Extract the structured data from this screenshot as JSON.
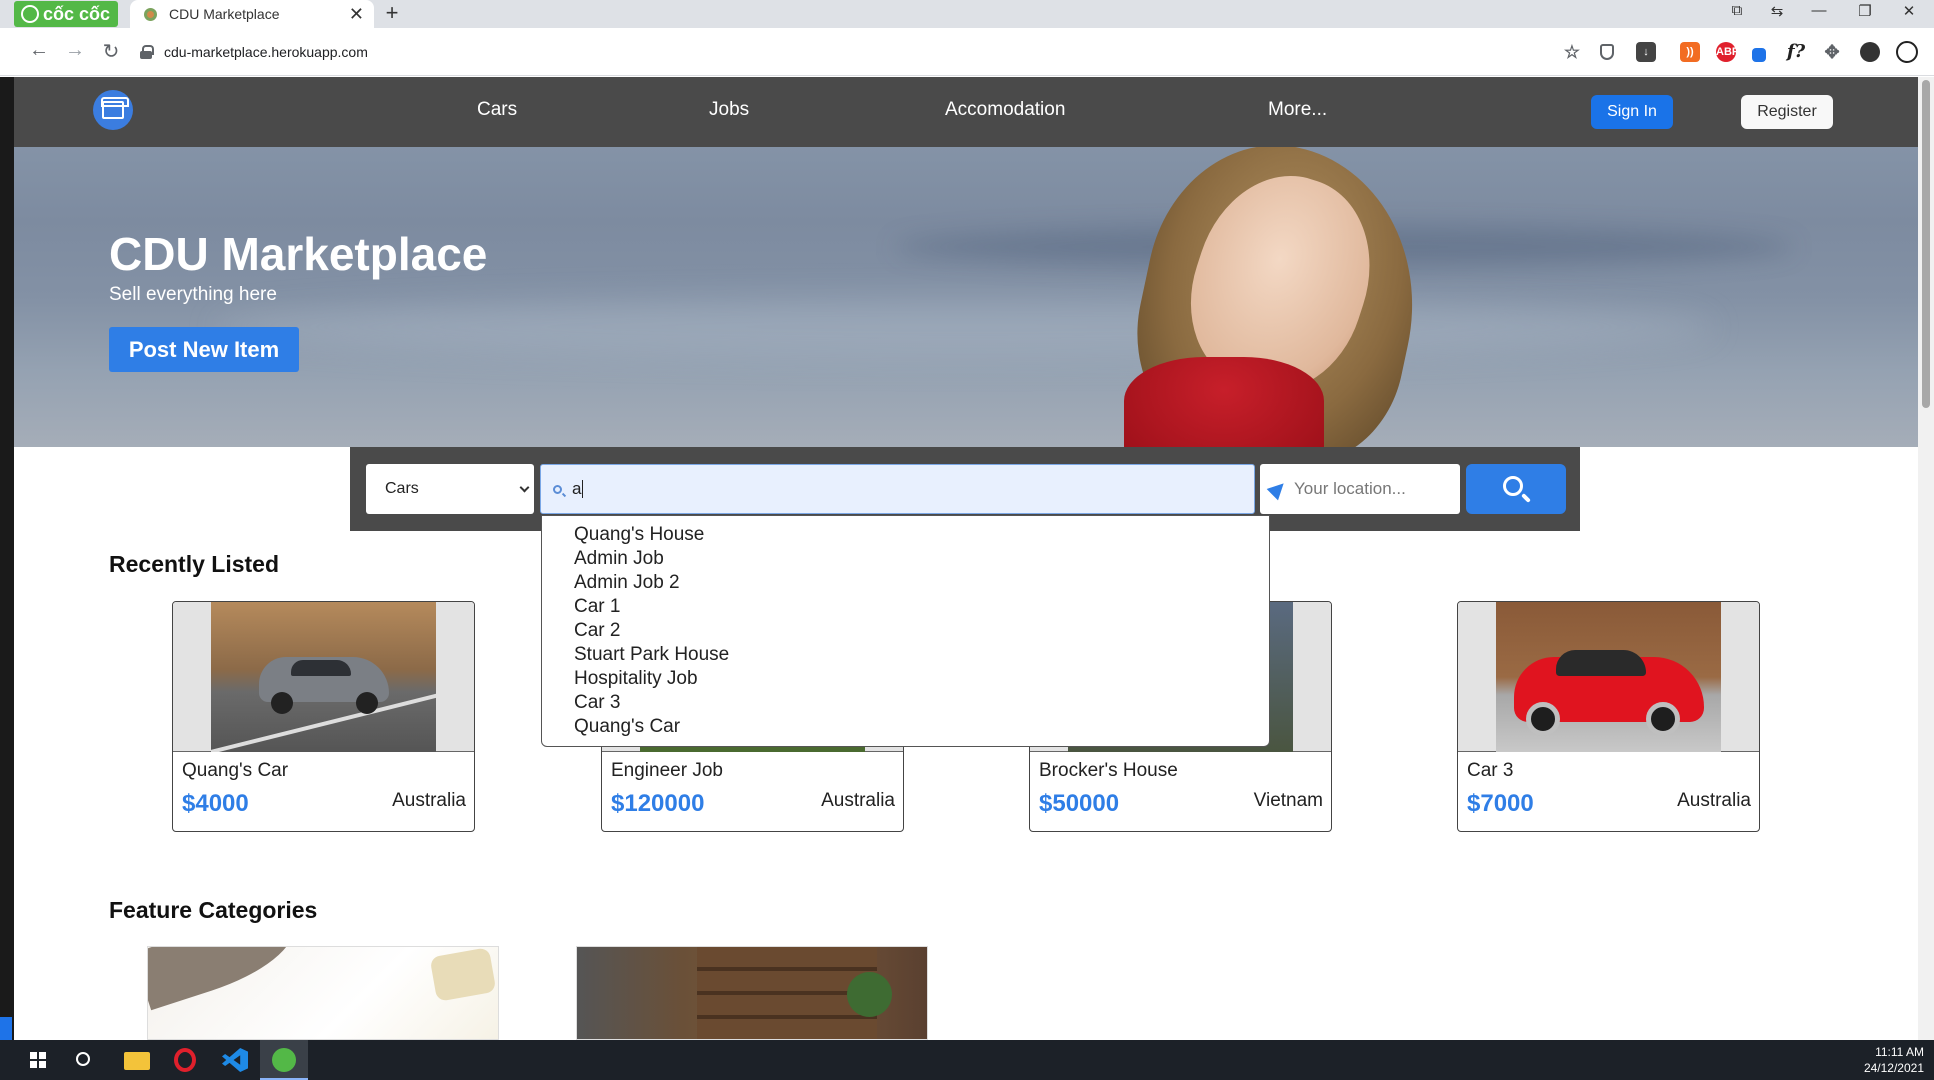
{
  "browser": {
    "brand_label": "cốc cốc",
    "tab_title": "CDU Marketplace",
    "tab_close": "✕",
    "new_tab": "+",
    "url": "cdu-marketplace.herokuapp.com",
    "window_controls": [
      "⧉",
      "⇆",
      "—",
      "❐",
      "✕"
    ]
  },
  "site_nav": {
    "links": [
      "Cars",
      "Jobs",
      "Accomodation",
      "More..."
    ],
    "signin_label": "Sign In",
    "register_label": "Register"
  },
  "hero": {
    "title": "CDU Marketplace",
    "subtitle": "Sell everything here",
    "post_button": "Post New Item"
  },
  "search": {
    "category": "Cars",
    "query": "a",
    "location_placeholder": "Your location...",
    "suggestions": [
      "Quang's House",
      "Admin Job",
      "Admin Job 2",
      "Car 1",
      "Car 2",
      "Stuart Park House",
      "Hospitality Job",
      "Car 3",
      "Quang's Car"
    ]
  },
  "recently_listed": {
    "title": "Recently Listed",
    "items": [
      {
        "name": "Quang's Car",
        "price": "$4000",
        "country": "Australia"
      },
      {
        "name": "Engineer Job",
        "price": "$120000",
        "country": "Australia"
      },
      {
        "name": "Brocker's House",
        "price": "$50000",
        "country": "Vietnam"
      },
      {
        "name": "Car 3",
        "price": "$7000",
        "country": "Australia"
      }
    ]
  },
  "feature_categories": {
    "title": "Feature Categories"
  },
  "taskbar": {
    "time": "11:11 AM",
    "date": "24/12/2021"
  },
  "colors": {
    "accent": "#2f7ee6",
    "nav_bg": "#4a4a4a",
    "brand_green": "#53b847"
  }
}
